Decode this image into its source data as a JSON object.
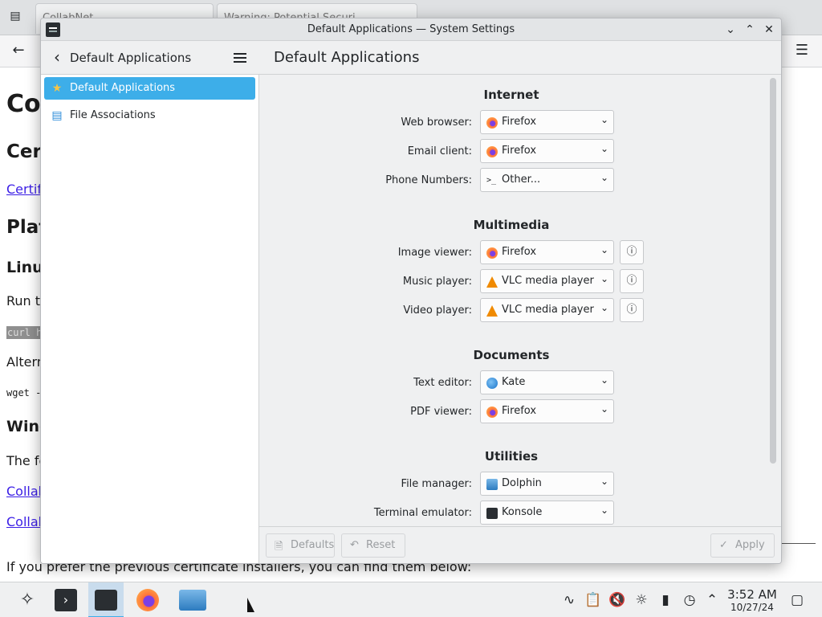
{
  "browser": {
    "tabs": [
      "CollabNet",
      "Warning: Potential Securi…"
    ],
    "page": {
      "h1": "Co",
      "h2": "Cer",
      "link1": "Certif",
      "h2b": "Plat",
      "h3": "Linu",
      "p1": "Run th",
      "code1": "curl h",
      "p2": "Altern",
      "mono": "wget -",
      "h3b": "Wind",
      "p3": "The fo",
      "link2": "Collab",
      "link3": "Collab",
      "bottom": "If you prefer the previous certificate installers, you can find them below:"
    }
  },
  "window": {
    "title": "Default Applications — System Settings",
    "controls": {
      "minimize": "⌄",
      "maximize": "⌃",
      "close": "✕"
    }
  },
  "sidebar": {
    "title": "Default Applications",
    "items": [
      {
        "label": "Default Applications",
        "icon": "★",
        "active": true
      },
      {
        "label": "File Associations",
        "icon": "▤",
        "active": false
      }
    ]
  },
  "main": {
    "title": "Default Applications",
    "sections": [
      {
        "title": "Internet",
        "rows": [
          {
            "label": "Web browser:",
            "value": "Firefox",
            "icon": "firefox"
          },
          {
            "label": "Email client:",
            "value": "Firefox",
            "icon": "firefox"
          },
          {
            "label": "Phone Numbers:",
            "value": "Other...",
            "icon": "other"
          }
        ]
      },
      {
        "title": "Multimedia",
        "rows": [
          {
            "label": "Image viewer:",
            "value": "Firefox",
            "icon": "firefox",
            "info": true
          },
          {
            "label": "Music player:",
            "value": "VLC media player",
            "icon": "vlc",
            "info": true
          },
          {
            "label": "Video player:",
            "value": "VLC media player",
            "icon": "vlc",
            "info": true
          }
        ]
      },
      {
        "title": "Documents",
        "rows": [
          {
            "label": "Text editor:",
            "value": "Kate",
            "icon": "kate"
          },
          {
            "label": "PDF viewer:",
            "value": "Firefox",
            "icon": "firefox"
          }
        ]
      },
      {
        "title": "Utilities",
        "rows": [
          {
            "label": "File manager:",
            "value": "Dolphin",
            "icon": "dolphin"
          },
          {
            "label": "Terminal emulator:",
            "value": "Konsole",
            "icon": "konsole"
          }
        ]
      }
    ],
    "footer": {
      "defaults": "Defaults",
      "reset": "Reset",
      "apply": "Apply"
    }
  },
  "taskbar": {
    "time": "3:52 AM",
    "date": "10/27/24"
  }
}
